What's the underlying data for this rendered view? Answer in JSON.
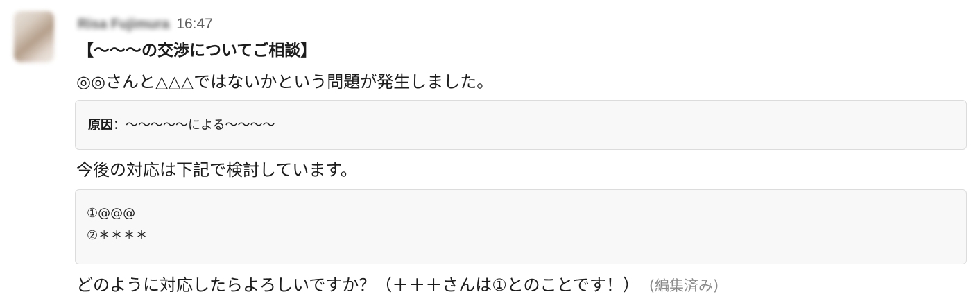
{
  "message": {
    "author": "Risa Fujimura",
    "timestamp": "16:47",
    "title": "【〜〜〜の交渉についてご相談】",
    "line1": "◎◎さんと△△△ではないかという問題が発生しました。",
    "cause_block": {
      "label": "原因",
      "text": "：〜〜〜〜〜による〜〜〜〜"
    },
    "line2": "今後の対応は下記で検討しています。",
    "options_block": {
      "items": [
        "①@@@",
        "②＊＊＊＊"
      ]
    },
    "line3": "どのように対応したらよろしいですか？（＋＋＋さんは①とのことです！）",
    "edited_label": "(編集済み)"
  }
}
